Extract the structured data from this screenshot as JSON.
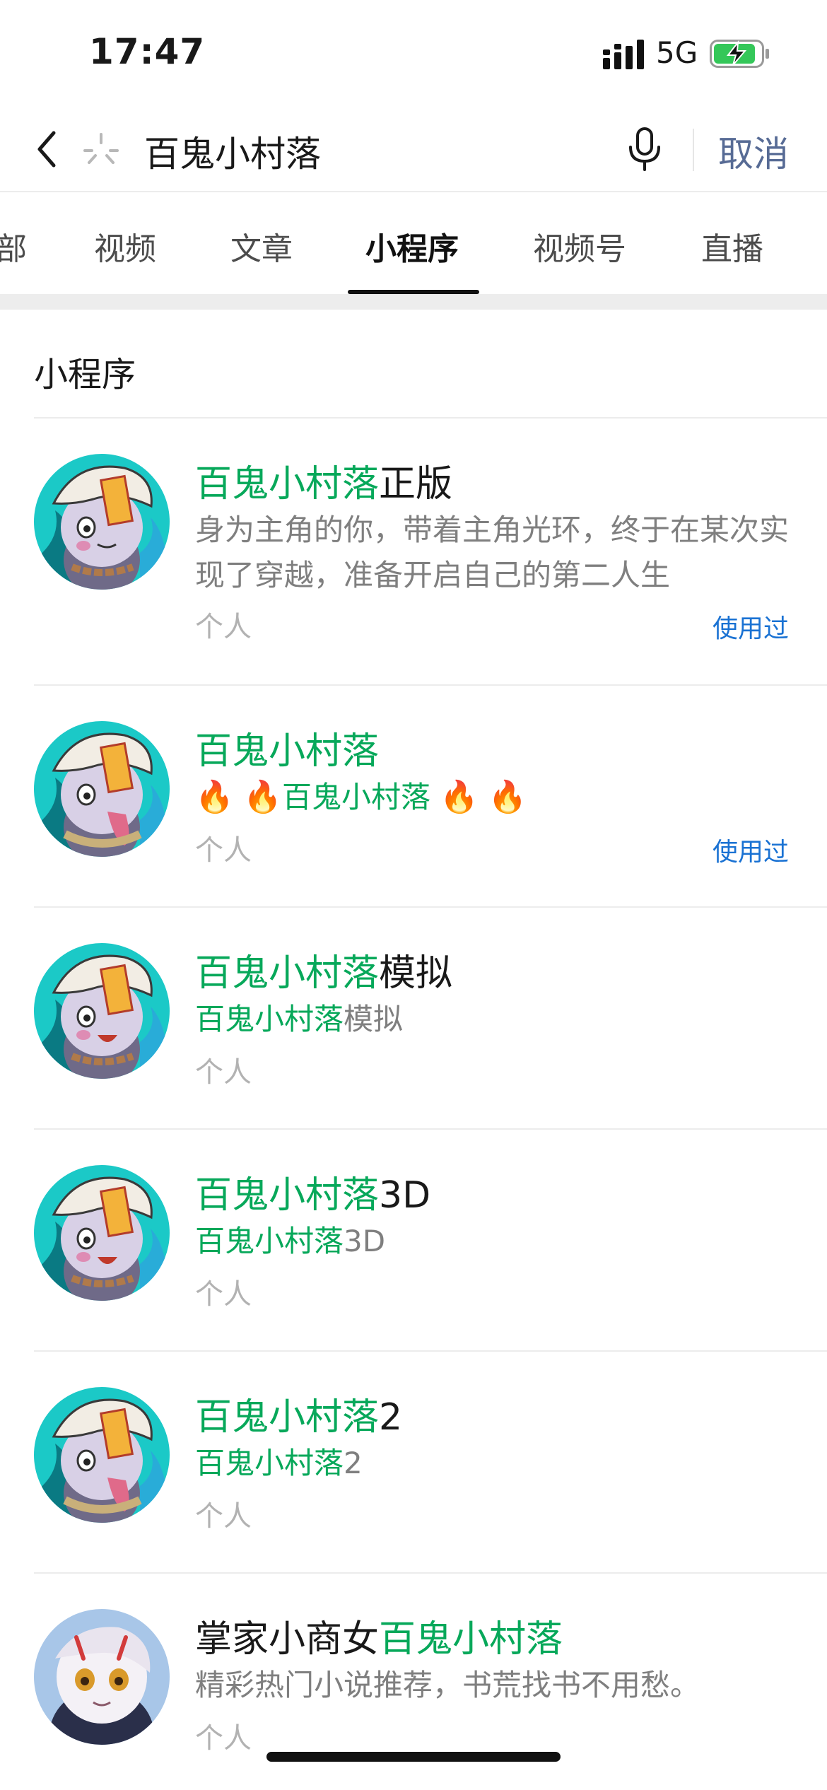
{
  "status_bar": {
    "time": "17:47",
    "network": "5G",
    "battery_charging": true,
    "icons": [
      "signal-icon",
      "battery-charging-icon"
    ]
  },
  "search": {
    "query": "百鬼小村落",
    "cancel_label": "取消",
    "icons": [
      "back-icon",
      "loading-icon",
      "microphone-icon"
    ]
  },
  "tabs": [
    {
      "label": "部"
    },
    {
      "label": "视频"
    },
    {
      "label": "文章"
    },
    {
      "label": "小程序",
      "active": true
    },
    {
      "label": "视频号"
    },
    {
      "label": "直播"
    }
  ],
  "section_title": "小程序",
  "results": [
    {
      "title_hl": "百鬼小村落",
      "title_rest": "正版",
      "desc": "身为主角的你，带着主角光环，终于在某次实现了穿越，准备开启自己的第二人生",
      "type": "个人",
      "used": "使用过"
    },
    {
      "title_hl": "百鬼小村落",
      "title_rest": "",
      "desc_hl": "百鬼小村落",
      "desc_emoji": "🔥",
      "type": "个人",
      "used": "使用过"
    },
    {
      "title_hl": "百鬼小村落",
      "title_rest": "模拟",
      "desc_hl": "百鬼小村落",
      "desc_rest": "模拟",
      "type": "个人"
    },
    {
      "title_hl": "百鬼小村落",
      "title_rest": "3D",
      "desc_hl": "百鬼小村落",
      "desc_rest": "3D",
      "type": "个人"
    },
    {
      "title_hl": "百鬼小村落",
      "title_rest": "2",
      "desc_hl": "百鬼小村落",
      "desc_rest": "2",
      "type": "个人"
    },
    {
      "title_pre": "掌家小商女",
      "title_hl": "百鬼小村落",
      "desc": "精彩热门小说推荐，书荒找书不用愁。",
      "type": "个人"
    }
  ],
  "colors": {
    "highlight": "#07a85a",
    "link_blue": "#1a72d3",
    "cancel": "#576b95",
    "secondary_text": "#7f7f7f",
    "tertiary_text": "#b2b2b2"
  }
}
